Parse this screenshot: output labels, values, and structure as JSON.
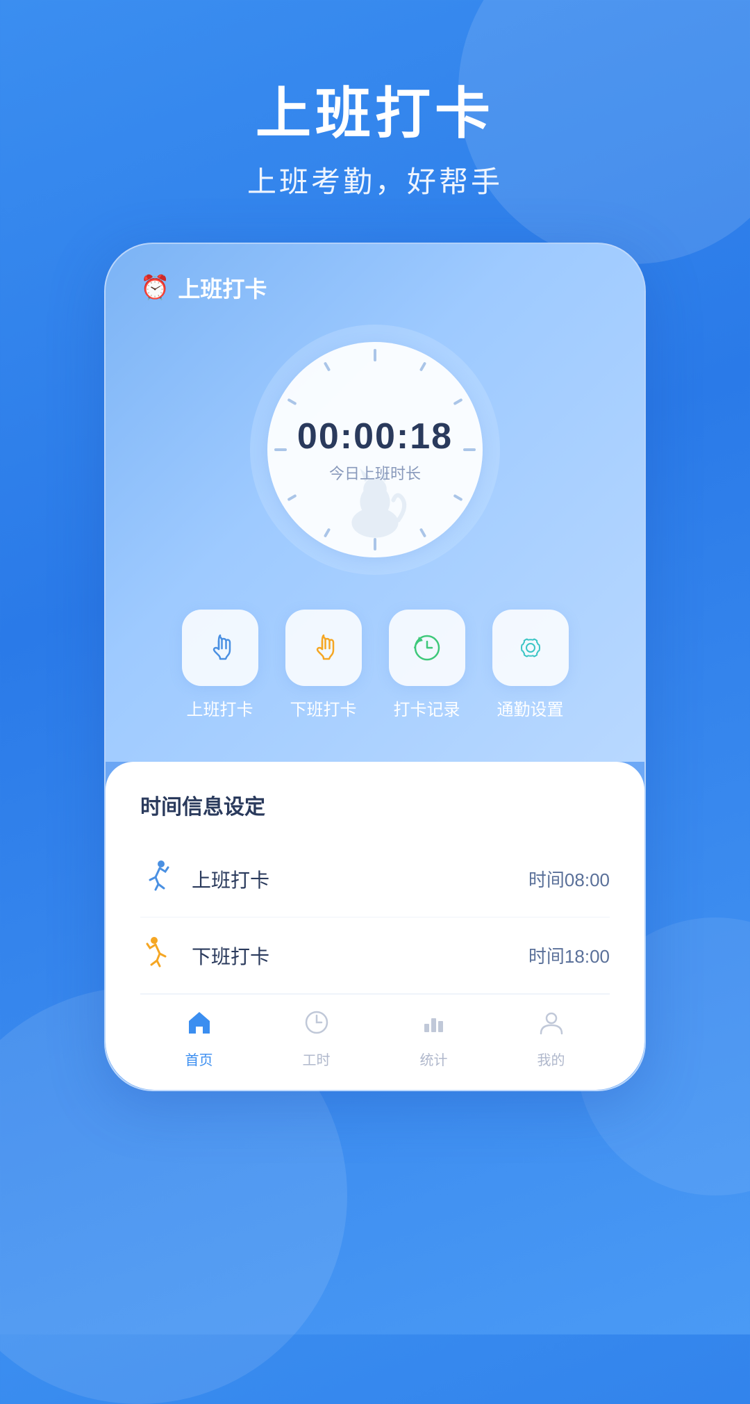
{
  "background": {
    "color1": "#3b8ef0",
    "color2": "#2a7ae8"
  },
  "header": {
    "title": "上班打卡",
    "subtitle": "上班考勤，好帮手"
  },
  "phone": {
    "app_title": "上班打卡",
    "clock": {
      "time": "00:00:18",
      "label": "今日上班时长"
    },
    "actions": [
      {
        "label": "上班打卡",
        "icon": "checkin"
      },
      {
        "label": "下班打卡",
        "icon": "checkout"
      },
      {
        "label": "打卡记录",
        "icon": "record"
      },
      {
        "label": "通勤设置",
        "icon": "settings"
      }
    ],
    "section_title": "时间信息设定",
    "info_rows": [
      {
        "label": "上班打卡",
        "time": "时间08:00",
        "type": "work-in"
      },
      {
        "label": "下班打卡",
        "time": "时间18:00",
        "type": "work-out"
      }
    ],
    "nav": [
      {
        "label": "首页",
        "icon": "home",
        "active": true
      },
      {
        "label": "工时",
        "icon": "clock",
        "active": false
      },
      {
        "label": "统计",
        "icon": "chart",
        "active": false
      },
      {
        "label": "我的",
        "icon": "user",
        "active": false
      }
    ]
  }
}
